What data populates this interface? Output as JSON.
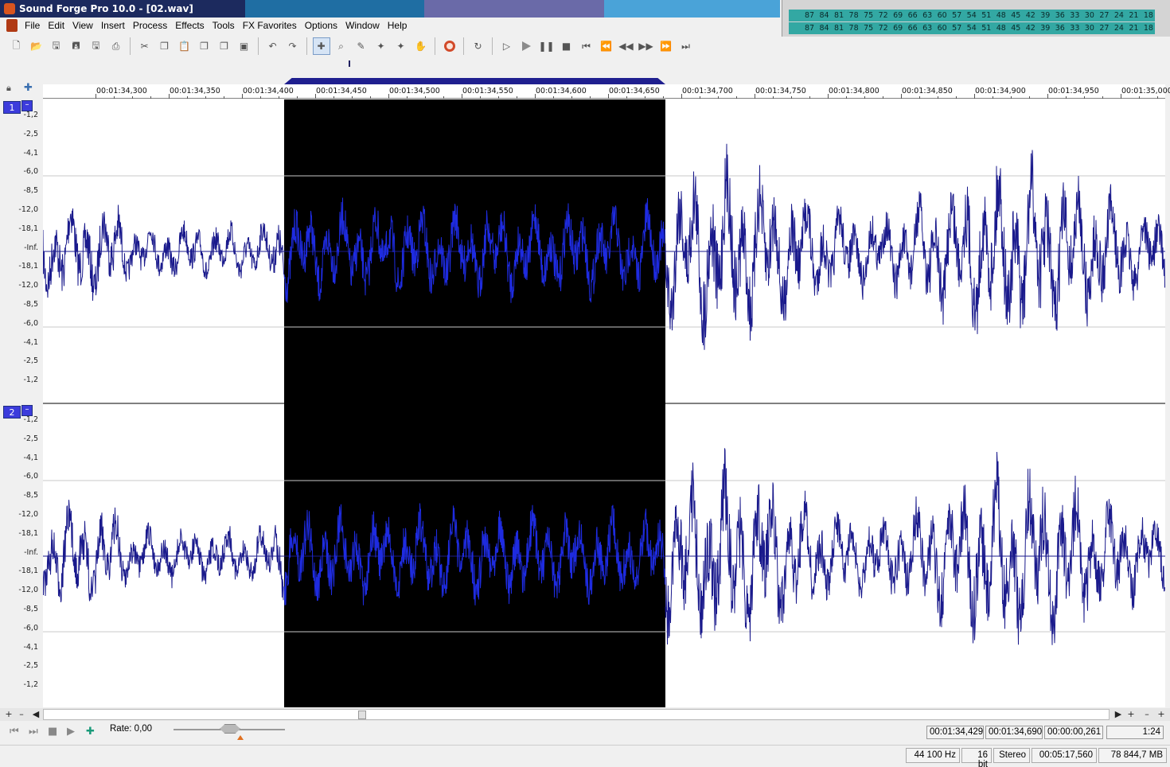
{
  "window": {
    "title": "Sound Forge Pro 10.0 - [02.wav]"
  },
  "menu": [
    "File",
    "Edit",
    "View",
    "Insert",
    "Process",
    "Effects",
    "Tools",
    "FX Favorites",
    "Options",
    "Window",
    "Help"
  ],
  "meter": {
    "rows": [
      [
        "87",
        "84",
        "81",
        "78",
        "75",
        "72",
        "69",
        "66",
        "63",
        "60",
        "57",
        "54",
        "51",
        "48",
        "45",
        "42",
        "39",
        "36",
        "33",
        "30",
        "27",
        "24",
        "21",
        "18"
      ],
      [
        "87",
        "84",
        "81",
        "78",
        "75",
        "72",
        "69",
        "66",
        "63",
        "60",
        "57",
        "54",
        "51",
        "48",
        "45",
        "42",
        "39",
        "36",
        "33",
        "30",
        "27",
        "24",
        "21",
        "18"
      ]
    ]
  },
  "toolbar": {
    "icons": [
      "new-icon",
      "open-icon",
      "save-icon",
      "save-as-icon",
      "render-icon",
      "print-icon",
      "cut-icon",
      "copy-icon",
      "paste-icon",
      "paste-special-icon",
      "mix-icon",
      "trim-crop-icon",
      "undo-icon",
      "redo-icon",
      "edit-tool-icon",
      "magnify-tool-icon",
      "pencil-tool-icon",
      "envelope-tool-icon",
      "event-tool-icon",
      "repair-icon",
      "record-icon",
      "loop-icon",
      "play-all-icon",
      "play-icon",
      "pause-icon",
      "stop-icon",
      "go-start-icon",
      "prev-marker-icon",
      "rewind-icon",
      "forward-icon",
      "next-marker-icon",
      "go-end-icon"
    ]
  },
  "ruler": {
    "labels": [
      "00:01:34,300",
      "00:01:34,350",
      "00:01:34,400",
      "00:01:34,450",
      "00:01:34,500",
      "00:01:34,550",
      "00:01:34,600",
      "00:01:34,650",
      "00:01:34,700",
      "00:01:34,750",
      "00:01:34,800",
      "00:01:34,850",
      "00:01:34,900",
      "00:01:34,950",
      "00:01:35,000"
    ]
  },
  "tracks": [
    {
      "label": "1",
      "db_labels": [
        "-1,2",
        "-2,5",
        "-4,1",
        "-6,0",
        "-8,5",
        "-12,0",
        "-18,1",
        "-Inf.",
        "-18,1",
        "-12,0",
        "-8,5",
        "-6,0",
        "-4,1",
        "-2,5",
        "-1,2"
      ]
    },
    {
      "label": "2",
      "db_labels": [
        "-1,2",
        "-2,5",
        "-4,1",
        "-6,0",
        "-8,5",
        "-12,0",
        "-18,1",
        "-Inf.",
        "-18,1",
        "-12,0",
        "-8,5",
        "-6,0",
        "-4,1",
        "-2,5",
        "-1,2"
      ]
    }
  ],
  "colors": {
    "waveform": "#1a1a8c",
    "selection_bg": "#000000",
    "selection_wave": "#1e2be0",
    "accent": "#3c3cdc"
  },
  "transport": {
    "rate_label": "Rate: 0,00",
    "sel_start": "00:01:34,429",
    "sel_end": "00:01:34,690",
    "sel_length": "00:00:00,261",
    "zoom": "1:24"
  },
  "status": {
    "sample_rate": "44 100 Hz",
    "bit_depth": "16 bit",
    "channels": "Stereo",
    "length": "00:05:17,560",
    "disk_free": "78 844,7 MB"
  }
}
